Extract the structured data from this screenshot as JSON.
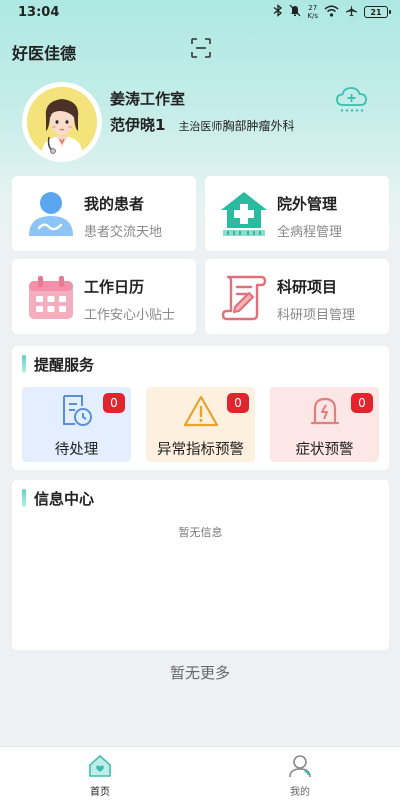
{
  "status_bar": {
    "time": "13:04",
    "speed_value": "27",
    "speed_unit": "K/s",
    "battery": "21"
  },
  "app": {
    "title": "好医佳德"
  },
  "profile": {
    "studio": "姜涛工作室",
    "doctor_name": "范伊晓1",
    "doctor_title": "主治医师",
    "department": "胸部肿瘤外科"
  },
  "cards": [
    {
      "title": "我的患者",
      "subtitle": "患者交流天地",
      "icon": "patient-icon"
    },
    {
      "title": "院外管理",
      "subtitle": "全病程管理",
      "icon": "hospital-icon"
    },
    {
      "title": "工作日历",
      "subtitle": "工作安心小贴士",
      "icon": "calendar-icon"
    },
    {
      "title": "科研项目",
      "subtitle": "科研项目管理",
      "icon": "research-icon"
    }
  ],
  "reminder": {
    "title": "提醒服务",
    "items": [
      {
        "label": "待处理",
        "count": "0",
        "icon": "pending-icon"
      },
      {
        "label": "异常指标预警",
        "count": "0",
        "icon": "warning-icon"
      },
      {
        "label": "症状预警",
        "count": "0",
        "icon": "alarm-icon"
      }
    ]
  },
  "info_center": {
    "title": "信息中心",
    "empty_text": "暂无信息"
  },
  "footer_text": "暂无更多",
  "bottom_nav": {
    "items": [
      {
        "label": "首页",
        "active": true
      },
      {
        "label": "我的",
        "active": false
      }
    ]
  },
  "colors": {
    "accent": "#3bbfae",
    "badge": "#e2242e",
    "pending_bg": "#e3efff",
    "warning_bg": "#fdf0de",
    "alarm_bg": "#fde6e6"
  }
}
